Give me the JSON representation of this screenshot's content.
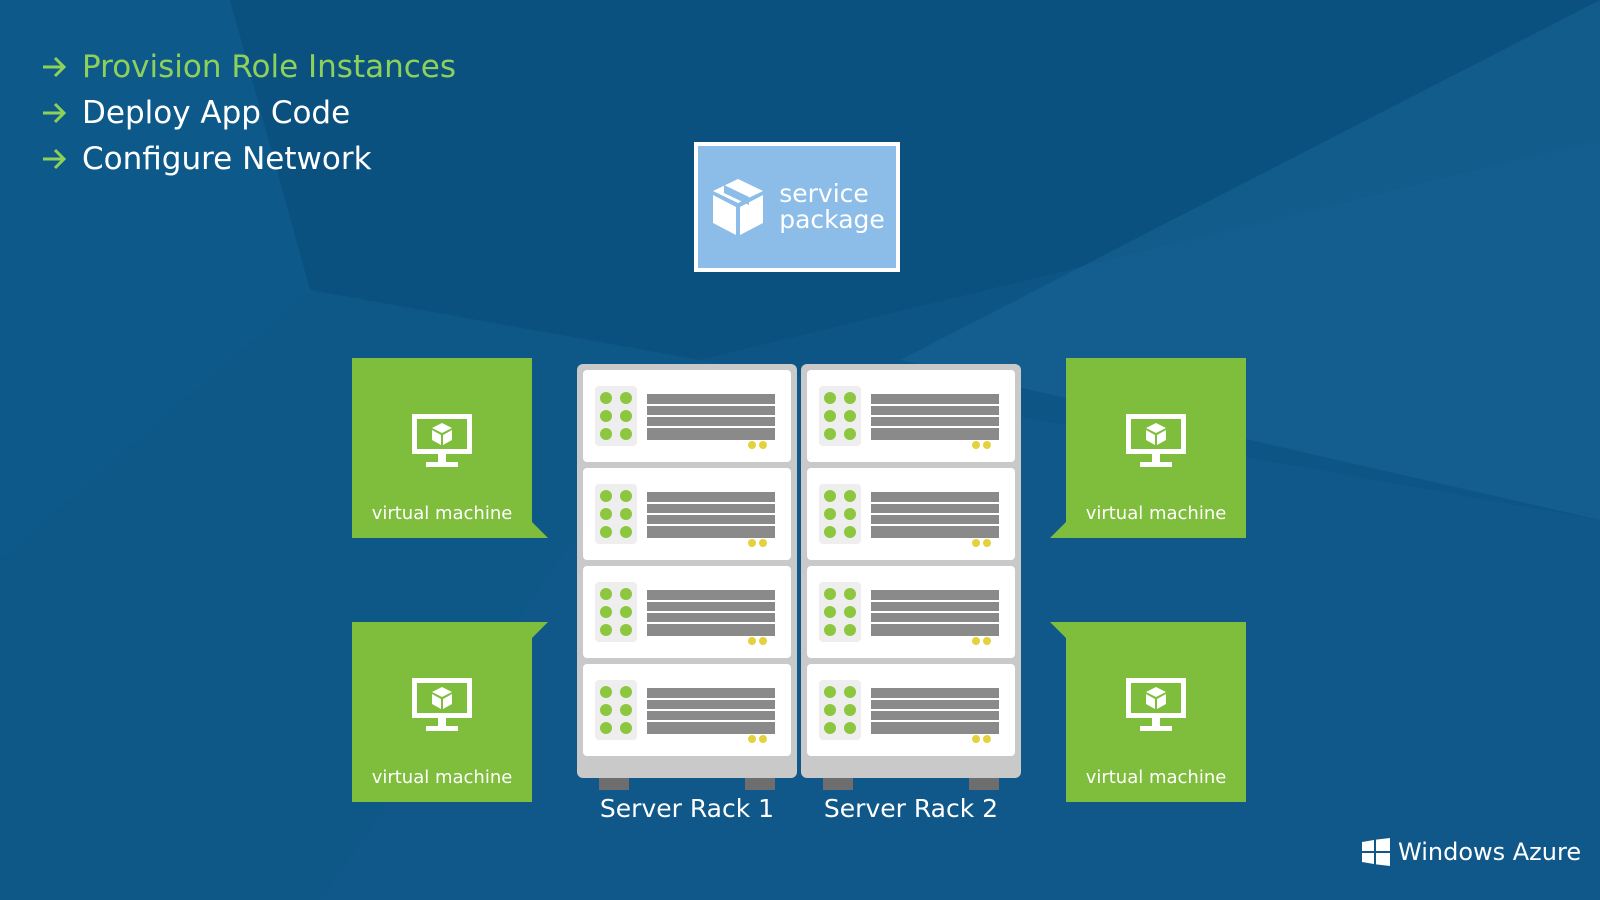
{
  "steps": [
    {
      "label": "Provision Role Instances",
      "active": true
    },
    {
      "label": "Deploy App Code",
      "active": false
    },
    {
      "label": "Configure Network",
      "active": false
    }
  ],
  "service_package": {
    "line1": "service",
    "line2": "package"
  },
  "virtual_machines": [
    {
      "label": "virtual machine"
    },
    {
      "label": "virtual machine"
    },
    {
      "label": "virtual machine"
    },
    {
      "label": "virtual machine"
    }
  ],
  "racks": [
    {
      "label": "Server Rack 1"
    },
    {
      "label": "Server Rack 2"
    }
  ],
  "brand": {
    "name": "Windows Azure"
  },
  "colors": {
    "background": "#0d5584",
    "accent_green": "#7fbd3d",
    "step_active": "#8ed15a",
    "package_blue": "#8cbde8",
    "rack_gray": "#c9c9c9"
  }
}
